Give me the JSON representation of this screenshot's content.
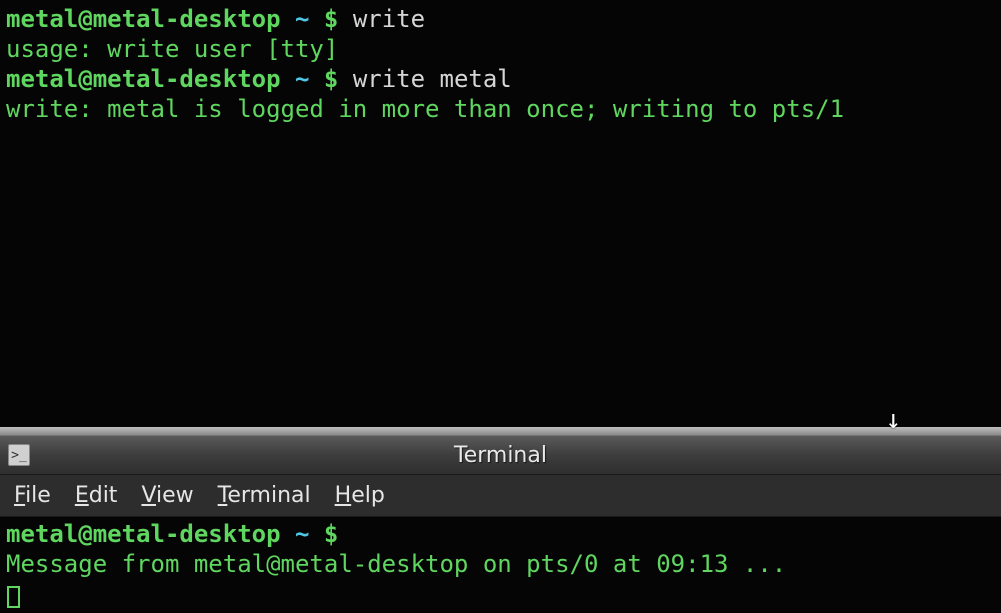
{
  "top_terminal": {
    "line1": {
      "prompt_user": "metal@metal-desktop",
      "prompt_tilde": " ~ ",
      "prompt_dollar": "$ ",
      "command": "write"
    },
    "line2": "usage: write user [tty]",
    "line3": {
      "prompt_user": "metal@metal-desktop",
      "prompt_tilde": " ~ ",
      "prompt_dollar": "$ ",
      "command": "write metal"
    },
    "line4": "write: metal is logged in more than once; writing to pts/1"
  },
  "cursor_arrow": "↓",
  "window": {
    "title": "Terminal"
  },
  "menu": {
    "file": "File",
    "edit": "Edit",
    "view": "View",
    "terminal": "Terminal",
    "help": "Help"
  },
  "bottom_terminal": {
    "line1": {
      "prompt_user": "metal@metal-desktop",
      "prompt_tilde": " ~ ",
      "prompt_dollar": "$ "
    },
    "line2": "Message from metal@metal-desktop on pts/0 at 09:13 ..."
  }
}
